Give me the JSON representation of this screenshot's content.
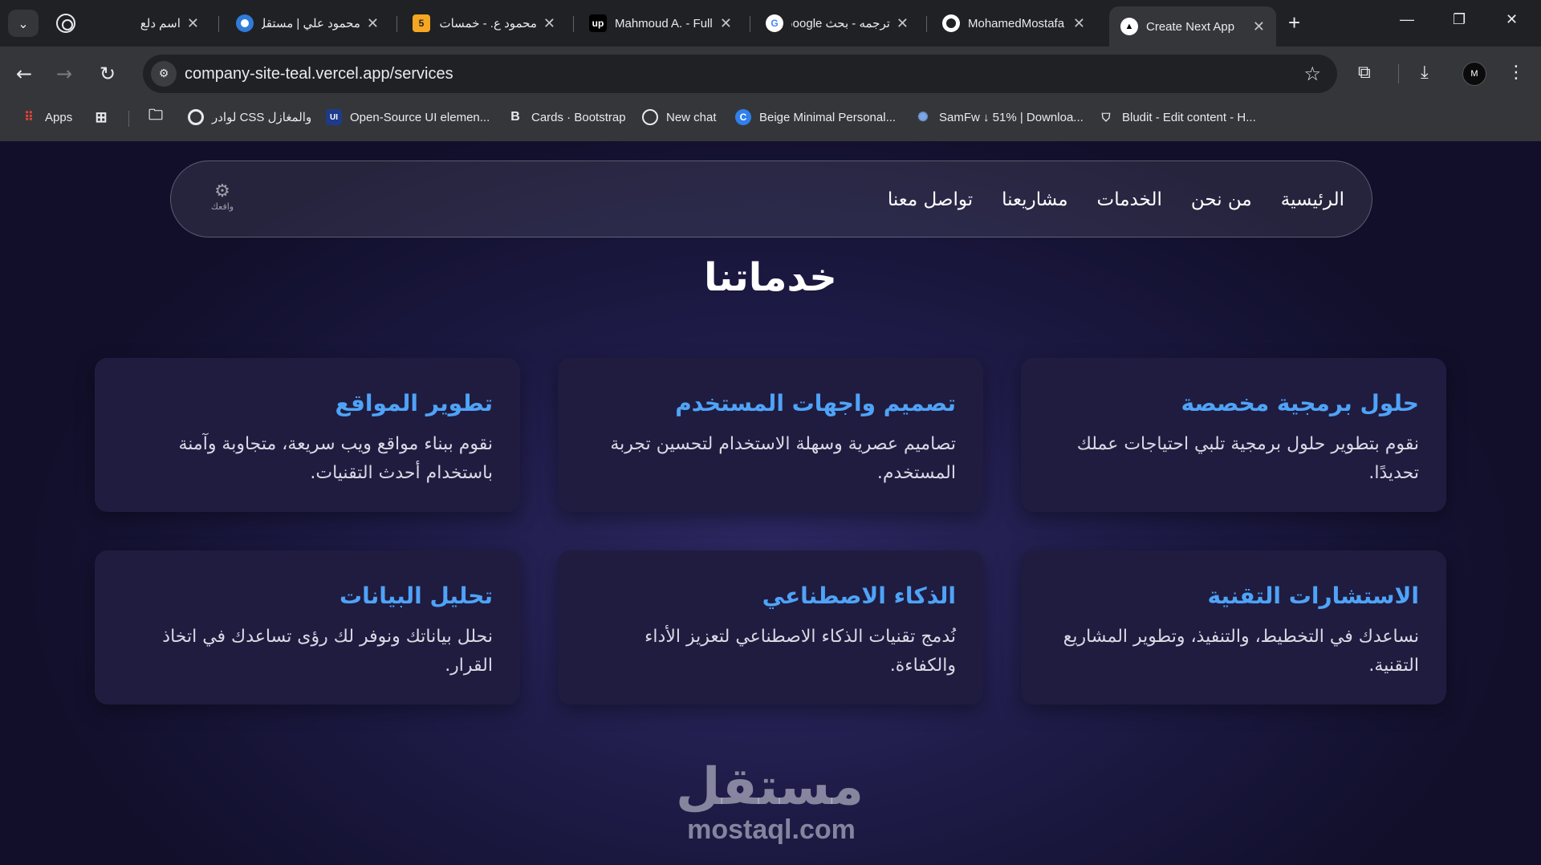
{
  "browser": {
    "tabs": [
      {
        "title": "اسم دلع",
        "icon": "chatgpt-icon",
        "active": false
      },
      {
        "title": "محمود علي | مستقل",
        "icon": "mostaql-icon",
        "active": false
      },
      {
        "title": "محمود ع. - خمسات",
        "icon": "khamsat-icon",
        "icon_text": "5",
        "active": false
      },
      {
        "title": "Mahmoud A. - Full",
        "icon": "upwork-icon",
        "icon_text": "up",
        "active": false
      },
      {
        "title": "ترجمه - بحث Google",
        "icon": "google-icon",
        "icon_text": "G",
        "active": false
      },
      {
        "title": "MohamedMostafa",
        "icon": "github-icon",
        "active": false
      },
      {
        "title": "Create Next App",
        "icon": "vercel-icon",
        "active": true
      }
    ],
    "url": "company-site-teal.vercel.app/services",
    "profile_initials": "M",
    "bookmarks": [
      {
        "label": "Apps",
        "icon": "apps-grid-icon"
      },
      {
        "label": "",
        "icon": "tab-groups-icon"
      },
      {
        "label": "",
        "icon": "folder-icon"
      },
      {
        "label": "لوادر CSS والمغازل",
        "icon": "loader-circle-icon"
      },
      {
        "label": "Open-Source UI elemen...",
        "icon": "uiverse-icon",
        "icon_text": "UI"
      },
      {
        "label": "Cards · Bootstrap",
        "icon": "bootstrap-icon",
        "icon_text": "B"
      },
      {
        "label": "New chat",
        "icon": "chatgpt-icon"
      },
      {
        "label": "Beige Minimal Personal...",
        "icon": "canva-icon",
        "icon_text": "C"
      },
      {
        "label": "SamFw ↓ 51% | Downloa...",
        "icon": "samfw-icon"
      },
      {
        "label": "Bludit - Edit content - H...",
        "icon": "bludit-icon"
      }
    ]
  },
  "site": {
    "logo_text": "وافعك",
    "nav": [
      "الرئيسية",
      "من نحن",
      "الخدمات",
      "مشاريعنا",
      "تواصل معنا"
    ],
    "heading": "خدماتنا",
    "services": [
      {
        "title": "حلول برمجية مخصصة",
        "desc": "نقوم بتطوير حلول برمجية تلبي احتياجات عملك تحديدًا."
      },
      {
        "title": "تصميم واجهات المستخدم",
        "desc": "تصاميم عصرية وسهلة الاستخدام لتحسين تجربة المستخدم."
      },
      {
        "title": "تطوير المواقع",
        "desc": "نقوم ببناء مواقع ويب سريعة، متجاوبة وآمنة باستخدام أحدث التقنيات."
      },
      {
        "title": "الاستشارات التقنية",
        "desc": "نساعدك في التخطيط، والتنفيذ، وتطوير المشاريع التقنية."
      },
      {
        "title": "الذكاء الاصطناعي",
        "desc": "نُدمج تقنيات الذكاء الاصطناعي لتعزيز الأداء والكفاءة."
      },
      {
        "title": "تحليل البيانات",
        "desc": "نحلل بياناتك ونوفر لك رؤى تساعدك في اتخاذ القرار."
      }
    ]
  },
  "watermark": {
    "arabic": "مستقل",
    "latin": "mostaql.com"
  },
  "colors": {
    "accent": "#4fa3f7",
    "card_bg": "#1f1c40",
    "page_bg": "#1d1a45"
  }
}
